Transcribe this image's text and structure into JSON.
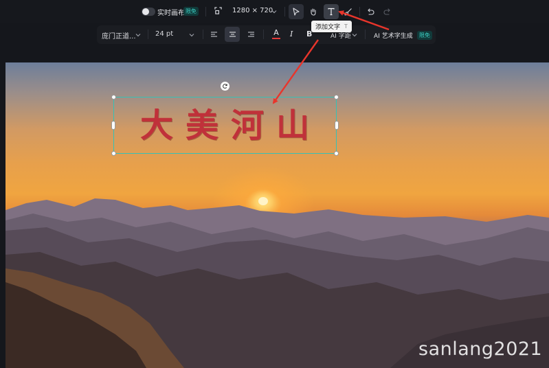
{
  "toolbar": {
    "realtime_label": "实时画布",
    "realtime_badge": "限免",
    "resolution": "1280 × 720"
  },
  "tooltip": {
    "text": "添加文字",
    "shortcut": "T"
  },
  "format_bar": {
    "font": "庞门正道...",
    "size": "24 pt",
    "spacing_label": "字距",
    "ai_prefix": "AI",
    "art_label": "艺术字生成",
    "art_badge": "限免"
  },
  "canvas": {
    "title_text": "大美河山",
    "title_color": "#c0313a"
  },
  "watermark": "sanlang2021",
  "colors": {
    "accent_teal": "#33c2b8",
    "arrow_red": "#e8352b",
    "text_color_swatch": "#e53a3a"
  }
}
